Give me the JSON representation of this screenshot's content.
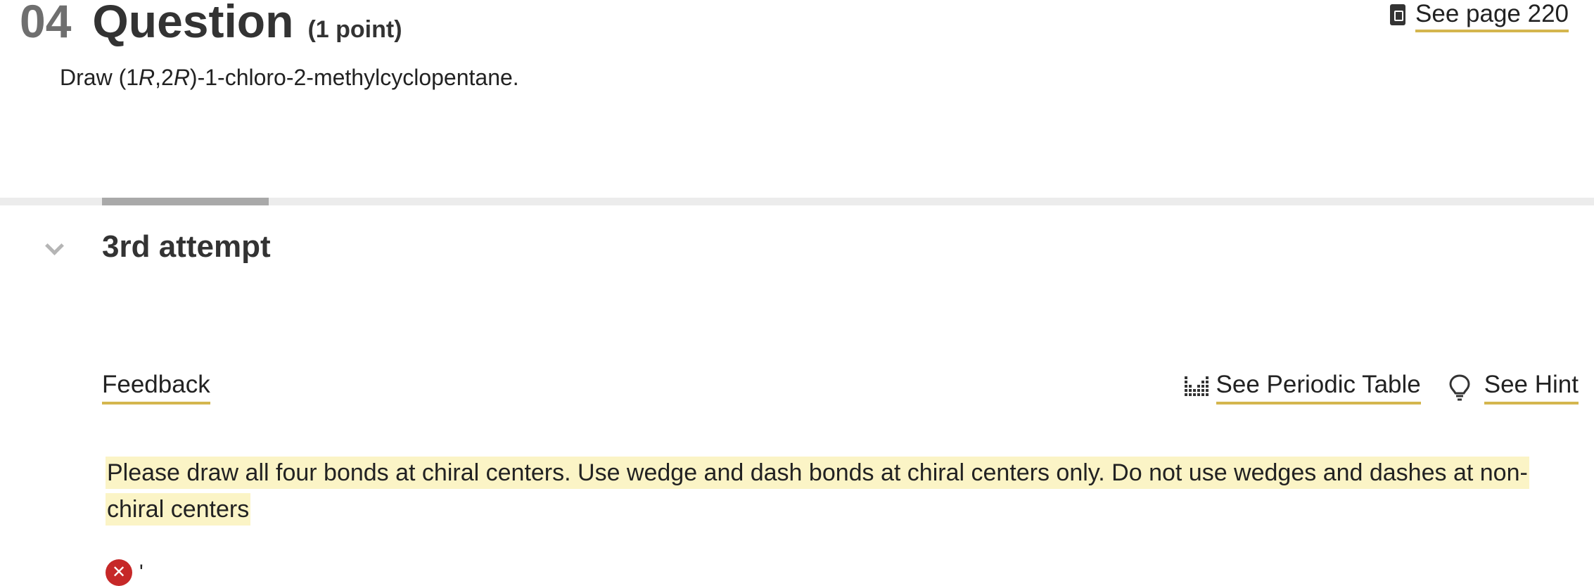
{
  "question": {
    "number": "04",
    "title": "Question",
    "points": "(1 point)",
    "prompt_prefix": "Draw (1",
    "prompt_r1": "R",
    "prompt_comma": ",2",
    "prompt_r2": "R",
    "prompt_suffix": ")-1-chloro-2-methylcyclopentane."
  },
  "ebook_link": {
    "label": "See page 220",
    "icon": "ebook-icon"
  },
  "attempt": {
    "title": "3rd attempt",
    "chevron_icon": "chevron-down-icon"
  },
  "feedback_tab": {
    "label": "Feedback"
  },
  "tools": {
    "periodic_table_label": "See Periodic Table",
    "periodic_table_icon": "periodic-table-icon",
    "hint_label": "See Hint",
    "hint_icon": "lightbulb-icon"
  },
  "feedback": {
    "message": "Please draw all four bonds at chiral centers. Use wedge and dash bonds at chiral centers only. Do not use wedges and dashes at non-chiral centers",
    "status_icon": "error-icon",
    "status_text": "'"
  },
  "colors": {
    "link_underline": "#d4b64e",
    "highlight": "#fbf4c6",
    "error": "#c62828",
    "divider": "#ececec",
    "divider_active": "#a9a9a9"
  }
}
